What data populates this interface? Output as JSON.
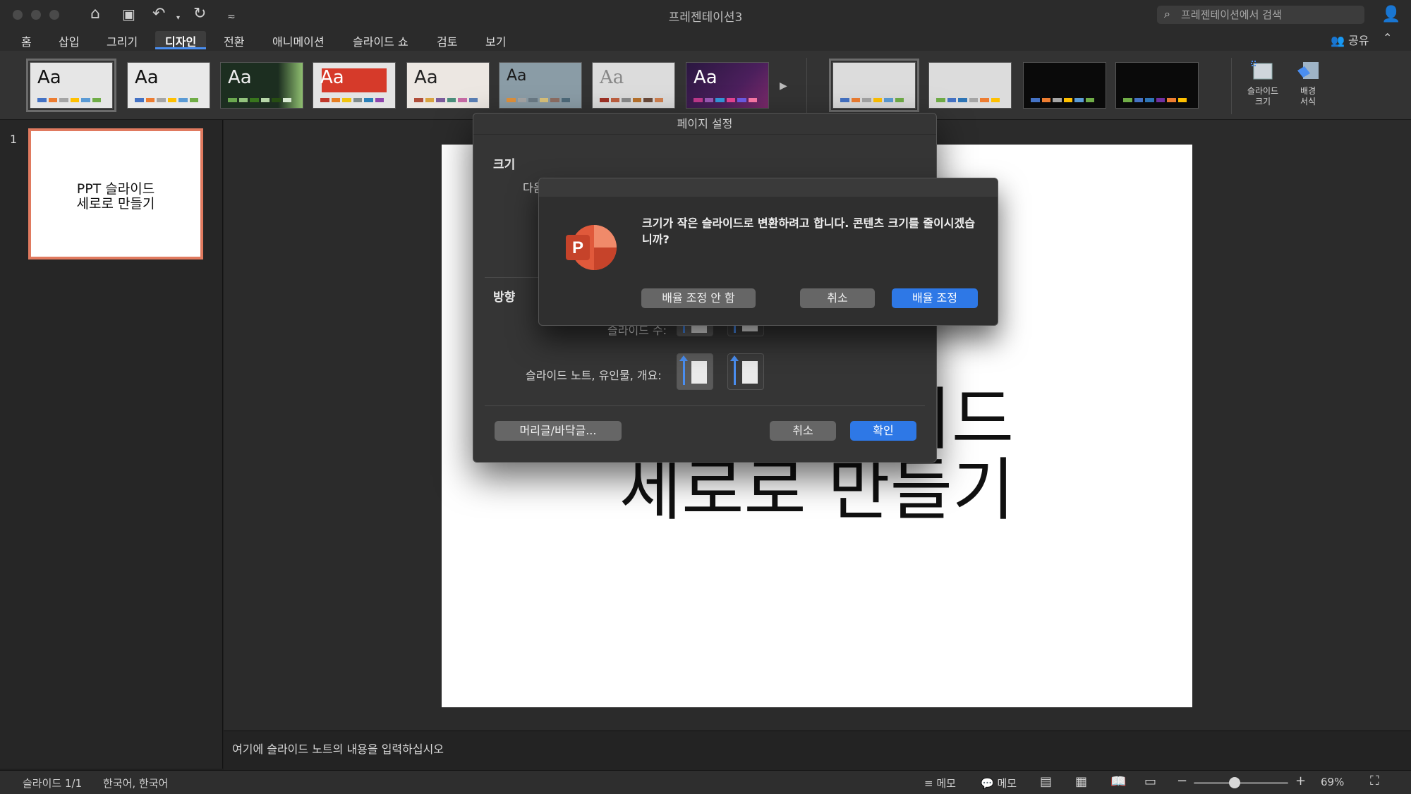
{
  "window": {
    "title": "프레젠테이션3",
    "search_placeholder": "프레젠테이션에서 검색"
  },
  "tabs": [
    {
      "label": "홈"
    },
    {
      "label": "삽입"
    },
    {
      "label": "그리기"
    },
    {
      "label": "디자인",
      "active": true
    },
    {
      "label": "전환"
    },
    {
      "label": "애니메이션"
    },
    {
      "label": "슬라이드 쇼"
    },
    {
      "label": "검토"
    },
    {
      "label": "보기"
    }
  ],
  "share_label": "공유",
  "ribbon": {
    "theme_sample": "Aa",
    "slide_size_label": "슬라이드\n크기",
    "format_background_label": "배경\n서식"
  },
  "thumbnail": {
    "number": "1",
    "text": "PPT 슬라이드\n세로로 만들기"
  },
  "slide": {
    "title": "PPT 슬라이드\n세로로 만들기"
  },
  "notes_placeholder": "여기에 슬라이드 노트의 내용을 입력하십시오",
  "statusbar": {
    "slide_counter": "슬라이드 1/1",
    "language": "한국어, 한국어",
    "notes_label": "메모",
    "comments_label": "메모",
    "zoom": "69%",
    "zoom_level": 0.43
  },
  "page_setup": {
    "title": "페이지 설정",
    "size_label": "크기",
    "size_partial": "다음",
    "orientation_label": "방향",
    "slides_label": "슬라이드 수:",
    "notes_handouts_label": "슬라이드 노트, 유인물, 개요:",
    "header_footer_button": "머리글/바닥글...",
    "cancel_button": "취소",
    "ok_button": "확인"
  },
  "alert": {
    "message": "크기가 작은 슬라이드로 변환하려고 합니다. 콘텐츠 크기를 줄이시겠습니까?",
    "dont_scale_button": "배율 조정 안 함",
    "cancel_button": "취소",
    "scale_button": "배율 조정"
  }
}
